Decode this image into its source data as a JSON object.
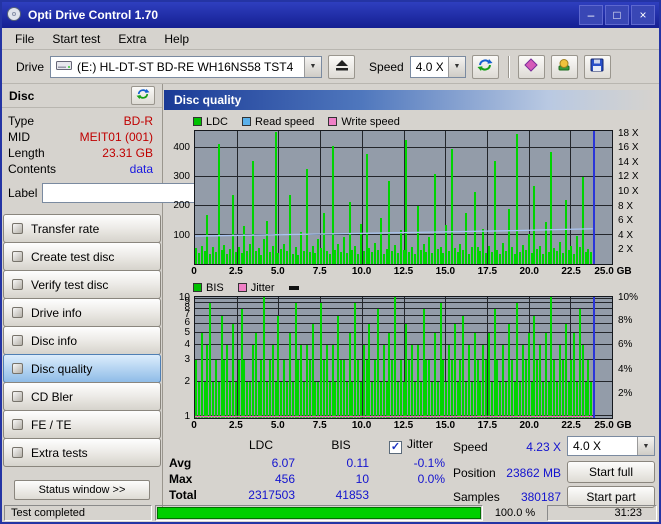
{
  "window": {
    "title": "Opti Drive Control 1.70",
    "controls": {
      "minimize": "–",
      "maximize": "□",
      "close": "×"
    }
  },
  "menu": {
    "items": [
      "File",
      "Start test",
      "Extra",
      "Help"
    ]
  },
  "toolbar": {
    "drive_label": "Drive",
    "drive_value": "(E:)  HL-DT-ST BD-RE  WH16NS58 TST4",
    "speed_label": "Speed",
    "speed_value": "4.0 X"
  },
  "sidebar": {
    "header": "Disc",
    "info": [
      {
        "label": "Type",
        "value": "BD-R"
      },
      {
        "label": "MID",
        "value": "MEIT01 (001)"
      },
      {
        "label": "Length",
        "value": "23.31 GB"
      },
      {
        "label": "Contents",
        "value": "data"
      }
    ],
    "label_caption": "Label",
    "label_value": "",
    "buttons": [
      "Transfer rate",
      "Create test disc",
      "Verify test disc",
      "Drive info",
      "Disc info",
      "Disc quality",
      "CD Bler",
      "FE / TE",
      "Extra tests"
    ],
    "active_button": "Disc quality",
    "status_window": "Status window >>"
  },
  "panel": {
    "title": "Disc quality"
  },
  "charts": [
    {
      "name": "ldc",
      "scale": "linear",
      "y_max": 460,
      "bar_color": "#00d400",
      "end_line_color": "#2b35d8",
      "end_line_frac": 0.954,
      "data_width_frac": 0.954,
      "legend": [
        {
          "label": "LDC",
          "color": "#00c000"
        },
        {
          "label": "Read speed",
          "color": "#5ab0ea"
        },
        {
          "label": "Write speed",
          "color": "#ef7fc6"
        }
      ],
      "y_left": [
        {
          "label": "400",
          "frac": 0.87
        },
        {
          "label": "300",
          "frac": 0.652
        },
        {
          "label": "200",
          "frac": 0.435
        },
        {
          "label": "100",
          "frac": 0.217
        }
      ],
      "y_right": [
        {
          "label": "18 X",
          "frac": 0.973
        },
        {
          "label": "16 X",
          "frac": 0.865
        },
        {
          "label": "14 X",
          "frac": 0.757
        },
        {
          "label": "12 X",
          "frac": 0.649
        },
        {
          "label": "10 X",
          "frac": 0.541
        },
        {
          "label": "8 X",
          "frac": 0.432
        },
        {
          "label": "6 X",
          "frac": 0.324
        },
        {
          "label": "4 X",
          "frac": 0.216
        },
        {
          "label": "2 X",
          "frac": 0.108
        }
      ],
      "x_ticks": [
        "0",
        "2.5",
        "5.0",
        "7.5",
        "10.0",
        "12.5",
        "15.0",
        "17.5",
        "20.0",
        "22.5",
        "25.0 GB"
      ],
      "lines": [
        {
          "color": "#aac4f2",
          "points": [
            [
              0,
              21
            ],
            [
              25,
              22.3
            ],
            [
              50,
              23.6
            ],
            [
              75,
              25
            ],
            [
              95.4,
              26.5
            ]
          ]
        }
      ],
      "values": [
        55,
        38,
        62,
        44,
        170,
        36,
        58,
        42,
        415,
        48,
        66,
        34,
        52,
        240,
        40,
        60,
        37,
        130,
        46,
        68,
        356,
        44,
        56,
        32,
        88,
        150,
        42,
        62,
        456,
        38,
        52,
        70,
        44,
        238,
        36,
        58,
        31,
        112,
        46,
        330,
        42,
        64,
        39,
        86,
        54,
        178,
        46,
        33,
        408,
        50,
        68,
        42,
        94,
        37,
        215,
        48,
        62,
        35,
        140,
        44,
        380,
        56,
        40,
        72,
        48,
        160,
        36,
        52,
        288,
        45,
        66,
        38,
        118,
        50,
        430,
        41,
        58,
        34,
        200,
        47,
        70,
        43,
        92,
        39,
        310,
        52,
        60,
        37,
        134,
        46,
        398,
        55,
        42,
        68,
        49,
        175,
        35,
        58,
        248,
        60,
        46,
        120,
        38,
        64,
        42,
        355,
        50,
        34,
        72,
        44,
        190,
        58,
        36,
        448,
        40,
        66,
        48,
        104,
        38,
        270,
        52,
        62,
        34,
        146,
        42,
        388,
        56,
        44,
        76,
        38,
        222,
        48,
        64,
        36,
        98,
        58,
        300,
        42,
        52,
        40
      ]
    },
    {
      "name": "bis",
      "scale": "log",
      "y_max": 10,
      "bar_color": "#00d400",
      "end_line_color": "#2b35d8",
      "end_line_frac": 0.954,
      "data_width_frac": 0.954,
      "legend_dash": true,
      "legend": [
        {
          "label": "BIS",
          "color": "#00c000"
        },
        {
          "label": "Jitter",
          "color": "#ef7fc6"
        }
      ],
      "y_left": [
        {
          "label": "10",
          "frac": 0.985
        },
        {
          "label": "9",
          "frac": 0.954
        },
        {
          "label": "8",
          "frac": 0.903
        },
        {
          "label": "7",
          "frac": 0.845
        },
        {
          "label": "6",
          "frac": 0.778
        },
        {
          "label": "5",
          "frac": 0.699
        },
        {
          "label": "4",
          "frac": 0.602
        },
        {
          "label": "3",
          "frac": 0.477
        },
        {
          "label": "2",
          "frac": 0.301
        },
        {
          "label": "1",
          "frac": 0.02
        }
      ],
      "y_right": [
        {
          "label": "10%",
          "frac": 0.98
        },
        {
          "label": "8%",
          "frac": 0.8
        },
        {
          "label": "6%",
          "frac": 0.6
        },
        {
          "label": "4%",
          "frac": 0.4
        },
        {
          "label": "2%",
          "frac": 0.2
        }
      ],
      "x_ticks": [
        "0",
        "2.5",
        "5.0",
        "7.5",
        "10.0",
        "12.5",
        "15.0",
        "17.5",
        "20.0",
        "22.5",
        "25.0 GB"
      ],
      "lines": [
        {
          "color": "#e96bb4",
          "points": [
            [
              0,
              1.2
            ],
            [
              95.4,
              1.2
            ]
          ]
        }
      ],
      "values": [
        3,
        2,
        5,
        2,
        4,
        9,
        2,
        3,
        2,
        7,
        3,
        4,
        2,
        6,
        2,
        3,
        8,
        3,
        2,
        2,
        4,
        5,
        2,
        3,
        10,
        2,
        3,
        4,
        2,
        7,
        2,
        3,
        2,
        5,
        2,
        9,
        3,
        4,
        2,
        4,
        3,
        6,
        2,
        2,
        9,
        3,
        4,
        2,
        4,
        2,
        7,
        3,
        3,
        2,
        5,
        2,
        9,
        3,
        2,
        4,
        3,
        6,
        2,
        3,
        8,
        2,
        4,
        2,
        5,
        3,
        10,
        2,
        3,
        2,
        6,
        3,
        4,
        2,
        4,
        2,
        8,
        3,
        3,
        2,
        5,
        2,
        9,
        3,
        2,
        4,
        3,
        6,
        2,
        3,
        7,
        2,
        4,
        2,
        5,
        3,
        2,
        4,
        3,
        5,
        2,
        8,
        3,
        2,
        4,
        2,
        6,
        3,
        2,
        9,
        2,
        4,
        3,
        5,
        2,
        7,
        3,
        4,
        2,
        5,
        2,
        10,
        3,
        2,
        4,
        3,
        6,
        2,
        3,
        5,
        2,
        8,
        4,
        2,
        3,
        2
      ]
    }
  ],
  "stats": {
    "col_ldc": "LDC",
    "col_bis": "BIS",
    "row_avg": "Avg",
    "row_max": "Max",
    "row_total": "Total",
    "ldc": {
      "avg": "6.07",
      "max": "456",
      "total": "2317503"
    },
    "bis": {
      "avg": "0.11",
      "max": "10",
      "total": "41853"
    },
    "jitter": {
      "label": "Jitter",
      "check": "✓",
      "avg": "-0.1%",
      "max": "0.0%"
    },
    "speed_label": "Speed",
    "speed_value": "4.23 X",
    "position_label": "Position",
    "position_value": "23862 MB",
    "samples_label": "Samples",
    "samples_value": "380187",
    "speed_select": "4.0 X",
    "start_full": "Start full",
    "start_part": "Start part"
  },
  "statusbar": {
    "text": "Test completed",
    "percent": "100.0 %",
    "time": "31:23",
    "progress_frac": 1
  }
}
